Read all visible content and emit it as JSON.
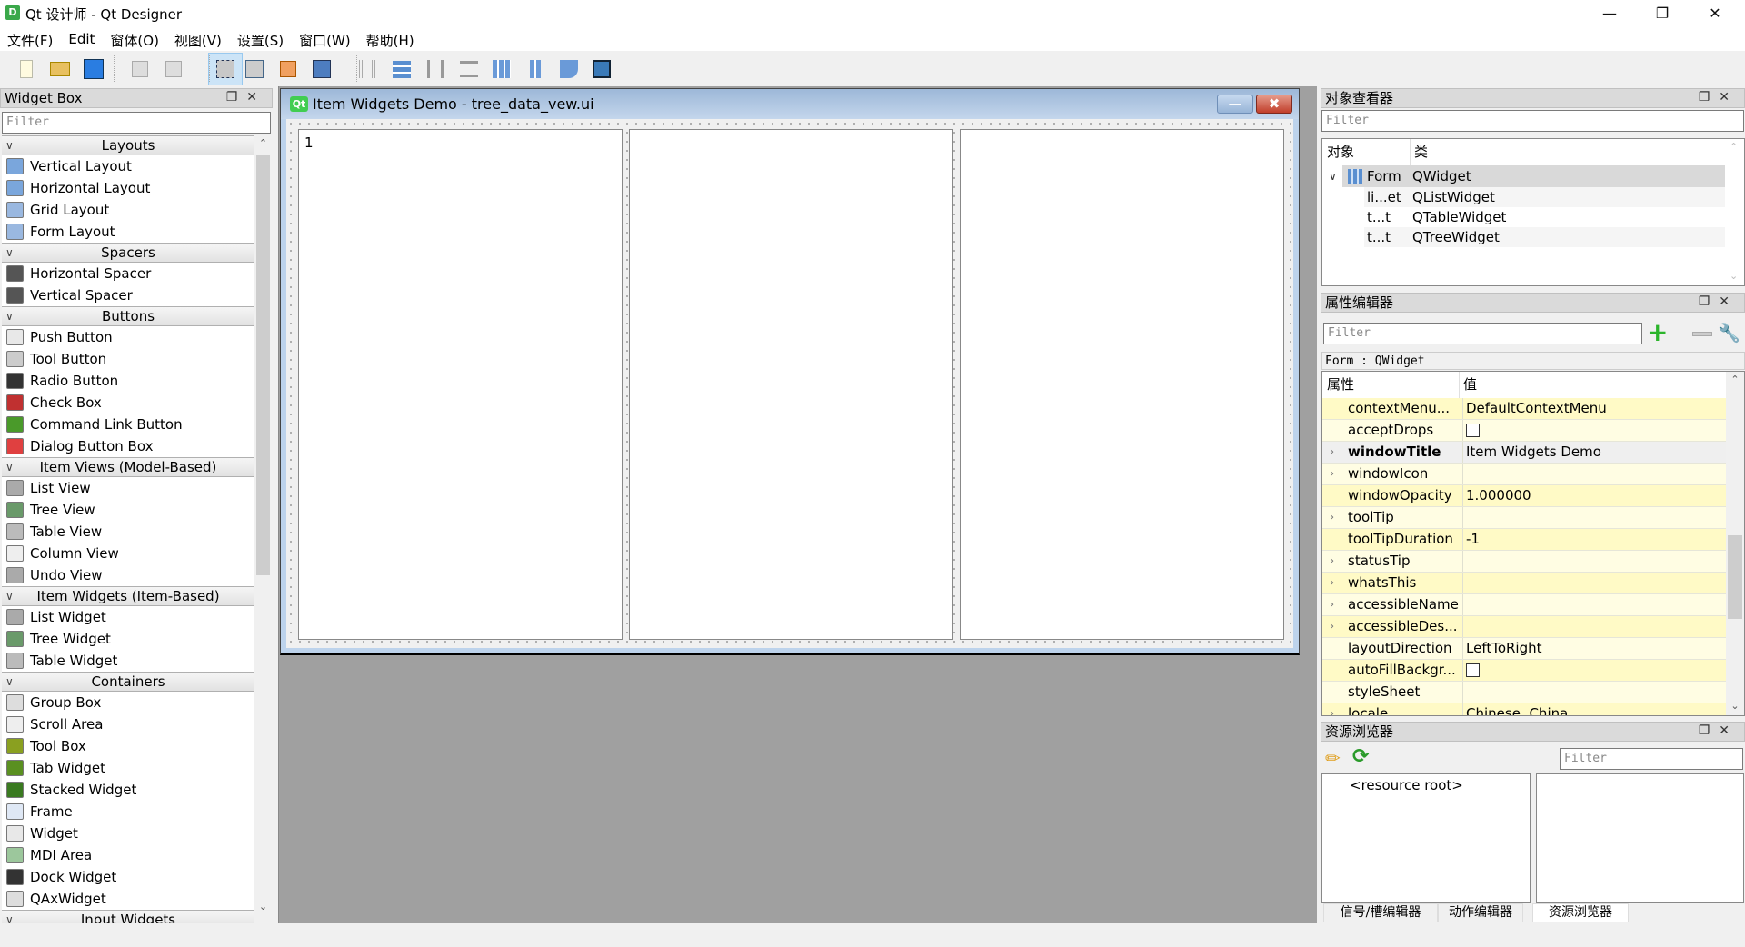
{
  "window": {
    "title": "Qt 设计师 - Qt Designer",
    "app_icon": "D",
    "controls": [
      "minimize-icon",
      "restore-icon",
      "close-icon"
    ]
  },
  "menu": [
    "文件(F)",
    "Edit",
    "窗体(O)",
    "视图(V)",
    "设置(S)",
    "窗口(W)",
    "帮助(H)"
  ],
  "toolbar": [
    "new-icon",
    "open-icon",
    "save-icon",
    "send-to-back-icon",
    "bring-to-front-icon",
    "edit-widgets-icon",
    "edit-signals-slots-icon",
    "edit-buddies-icon",
    "edit-tab-order-icon",
    "layout-horizontal-icon",
    "layout-vertical-icon",
    "layout-horizontal-splitter-icon",
    "layout-vertical-splitter-icon",
    "layout-grid-icon",
    "layout-form-icon",
    "break-layout-icon",
    "adjust-size-icon"
  ],
  "widget_box": {
    "title": "Widget Box",
    "filter_placeholder": "Filter",
    "categories": [
      {
        "name": "Layouts",
        "items": [
          "Vertical Layout",
          "Horizontal Layout",
          "Grid Layout",
          "Form Layout"
        ]
      },
      {
        "name": "Spacers",
        "items": [
          "Horizontal Spacer",
          "Vertical Spacer"
        ]
      },
      {
        "name": "Buttons",
        "items": [
          "Push Button",
          "Tool Button",
          "Radio Button",
          "Check Box",
          "Command Link Button",
          "Dialog Button Box"
        ]
      },
      {
        "name": "Item Views (Model-Based)",
        "items": [
          "List View",
          "Tree View",
          "Table View",
          "Column View",
          "Undo View"
        ]
      },
      {
        "name": "Item Widgets (Item-Based)",
        "items": [
          "List Widget",
          "Tree Widget",
          "Table Widget"
        ]
      },
      {
        "name": "Containers",
        "items": [
          "Group Box",
          "Scroll Area",
          "Tool Box",
          "Tab Widget",
          "Stacked Widget",
          "Frame",
          "Widget",
          "MDI Area",
          "Dock Widget",
          "QAxWidget"
        ]
      },
      {
        "name": "Input Widgets",
        "items": []
      }
    ]
  },
  "form": {
    "title": "Item Widgets Demo - tree_data_vew.ui",
    "icon": "Qt",
    "list_item": "1"
  },
  "object_inspector": {
    "title": "对象查看器",
    "filter_placeholder": "Filter",
    "col_object": "对象",
    "col_class": "类",
    "rows": [
      {
        "name": "Form",
        "class": "QWidget"
      },
      {
        "name": "li...et",
        "class": "QListWidget"
      },
      {
        "name": "t...t",
        "class": "QTableWidget"
      },
      {
        "name": "t...t",
        "class": "QTreeWidget"
      }
    ]
  },
  "property_editor": {
    "title": "属性编辑器",
    "filter_placeholder": "Filter",
    "context": "Form : QWidget",
    "col_property": "属性",
    "col_value": "值",
    "rows": [
      {
        "name": "contextMenu...",
        "value": "DefaultContextMenu",
        "expandable": false
      },
      {
        "name": "acceptDrops",
        "value": "",
        "checkbox": true,
        "checked": false,
        "expandable": false
      },
      {
        "name": "windowTitle",
        "value": "Item Widgets Demo",
        "expandable": true,
        "bold": true
      },
      {
        "name": "windowIcon",
        "value": "",
        "expandable": true
      },
      {
        "name": "windowOpacity",
        "value": "1.000000",
        "expandable": false
      },
      {
        "name": "toolTip",
        "value": "",
        "expandable": true
      },
      {
        "name": "toolTipDuration",
        "value": "-1",
        "expandable": false
      },
      {
        "name": "statusTip",
        "value": "",
        "expandable": true
      },
      {
        "name": "whatsThis",
        "value": "",
        "expandable": true
      },
      {
        "name": "accessibleName",
        "value": "",
        "expandable": true
      },
      {
        "name": "accessibleDes...",
        "value": "",
        "expandable": true
      },
      {
        "name": "layoutDirection",
        "value": "LeftToRight",
        "expandable": false
      },
      {
        "name": "autoFillBackgr...",
        "value": "",
        "checkbox": true,
        "checked": false,
        "expandable": false
      },
      {
        "name": "styleSheet",
        "value": "",
        "expandable": false
      },
      {
        "name": "locale",
        "value": "Chinese, China",
        "expandable": true
      }
    ]
  },
  "resource_browser": {
    "title": "资源浏览器",
    "filter_placeholder": "Filter",
    "root": "<resource root>"
  },
  "bottom_tabs": [
    "信号/槽编辑器",
    "动作编辑器",
    "资源浏览器"
  ],
  "colors": {
    "accent": "#3aa84a",
    "selection": "#cce4f7",
    "prop_yellow": "#fffac6",
    "prop_light": "#fffde3"
  }
}
